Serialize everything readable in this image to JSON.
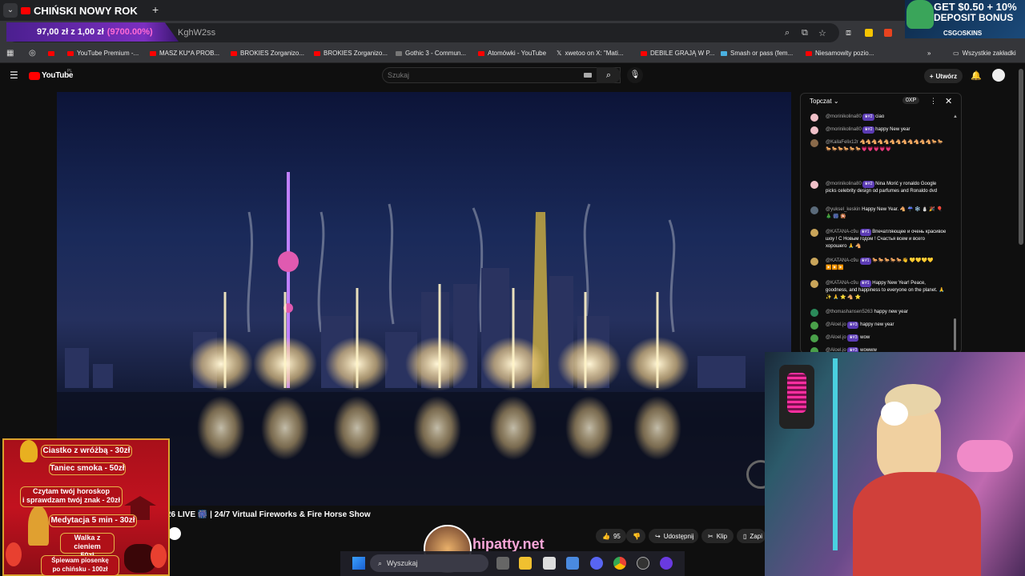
{
  "browser": {
    "tab_title": "CHIŃSKI NOWY ROK",
    "url_fragment": "KghW2ss",
    "balance_overlay": {
      "text": "97,00 zł z 1,00 zł",
      "percent": "(9700.00%)"
    },
    "bookmarks": [
      "YouTube Premium -...",
      "MASZ KU*A PROB...",
      "BROKIES Zorganizo...",
      "BROKIES Zorganizo...",
      "Gothic 3 - Commun...",
      "Atomówki - YouTube",
      "xwetoo on X: \"Mati...",
      "DEBILE GRAJĄ W P...",
      "Smash or pass (fem...",
      "Niesamowity pozio..."
    ],
    "all_bookmarks": "Wszystkie zakładki"
  },
  "promo": {
    "line1": "GET $0.50 + 10%",
    "line2": "DEPOSIT BONUS",
    "brand": "CSG⭘SKINS"
  },
  "youtube": {
    "logo_text": "YouTube",
    "logo_region": "PL",
    "search_placeholder": "Szukaj",
    "create_label": "Utwórz",
    "video_title": "26 LIVE 🎆 | 24/7 Virtual Fireworks & Fire Horse Show",
    "actions": {
      "likes": "95",
      "share": "Udostępnij",
      "clip": "Klip",
      "save": "Zapi"
    }
  },
  "chat": {
    "title": "Topczat",
    "xp": "0XP",
    "messages": [
      {
        "user": "@morinikolina80",
        "badge": "#2",
        "text": "ciao",
        "avatar_color": "#f0c0c8"
      },
      {
        "user": "@morinikolina80",
        "badge": "#2",
        "text": "happy New year",
        "avatar_color": "#f0c0c8"
      },
      {
        "user": "@KailaFelix12r",
        "badge": "",
        "text": "🐴🐴🐴🐴🐴🐴🐴🐴🐴🐴🐴🐴🐎🐎🐎🐎🐎🐎🐎🐎💗💗💗💗💗",
        "avatar_color": "#8a6a4a"
      },
      {
        "user": "@morinikolina80",
        "badge": "#2",
        "text": "Nina Morić y ronaldo Google picks celebrity design od parfumes and Ronaldo dvd",
        "avatar_color": "#f0c0c8"
      },
      {
        "user": "@yuksel_keskin",
        "badge": "",
        "text": "Happy New Year. 🐴 ☔ ❄️ ⛄ 🎉 🎈 🎄 🎆 🎇",
        "avatar_color": "#5a6a7a"
      },
      {
        "user": "@KATANA-c9u",
        "badge": "#1",
        "text": "Впечатляющее и очень красивое шоу ! С Новым годом ! Счастья всем и всего хорошего 🙏 🐴",
        "avatar_color": "#c9a55a"
      },
      {
        "user": "@KATANA-c9u",
        "badge": "#1",
        "text": "🐎🐎🐎🐎🐎👋 💛💛💛💛▶️▶️▶️",
        "avatar_color": "#c9a55a"
      },
      {
        "user": "@KATANA-c9u",
        "badge": "#1",
        "text": "Happy New Year! Peace, goodness, and happiness to everyone on the planet. 🙏 ✨ 🙏 ⭐ 🐴 ⭐",
        "avatar_color": "#c9a55a"
      },
      {
        "user": "@thomashansen5263",
        "badge": "",
        "text": "happy new year",
        "avatar_color": "#2a8a5a"
      },
      {
        "user": "@Aloel.jo",
        "badge": "#3",
        "text": "happy new year",
        "avatar_color": "#4aa04a"
      },
      {
        "user": "@Aloel.jo",
        "badge": "#3",
        "text": "wow",
        "avatar_color": "#4aa04a"
      },
      {
        "user": "@Aloel.jo",
        "badge": "#3",
        "text": "wowww",
        "avatar_color": "#4aa04a"
      }
    ]
  },
  "overlay_menu": [
    "Ciastko z wróżbą - 30zł",
    "Taniec smoka - 50zł",
    "Czytam twój horoskop\ni sprawdzam twój znak - 20zł",
    "Medytacja 5 min - 30zł",
    "Walka z cieniem\n50zł",
    "Śpiewam piosenkę\npo chińsku - 100zł"
  ],
  "streamer": {
    "handle": "hipatty.net"
  },
  "taskbar": {
    "search": "Wyszukaj"
  }
}
